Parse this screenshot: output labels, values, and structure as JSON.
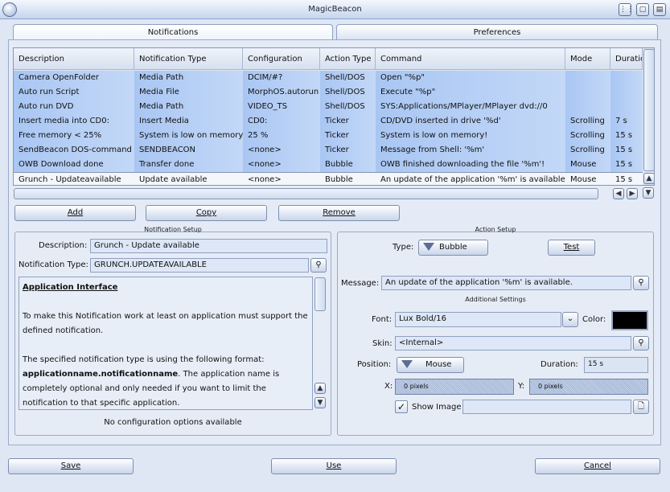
{
  "window": {
    "title": "MagicBeacon",
    "buttons": [
      "⋮⋮",
      "▢",
      "▤"
    ]
  },
  "tabs": [
    {
      "label": "Notifications",
      "active": true
    },
    {
      "label": "Preferences",
      "active": false
    }
  ],
  "list": {
    "columns": [
      "Description",
      "Notification Type",
      "Configuration",
      "Action Type",
      "Command",
      "Mode",
      "Duration"
    ],
    "rows": [
      [
        "Camera OpenFolder",
        "Media Path",
        "DCIM/#?",
        "Shell/DOS",
        "Open \"%p\"",
        "",
        ""
      ],
      [
        "Auto run Script",
        "Media File",
        "MorphOS.autorun",
        "Shell/DOS",
        "Execute \"%p\"",
        "",
        ""
      ],
      [
        "Auto run DVD",
        "Media Path",
        "VIDEO_TS",
        "Shell/DOS",
        "SYS:Applications/MPlayer/MPlayer dvd://0",
        "",
        ""
      ],
      [
        "Insert media into CD0:",
        "Insert Media",
        "CD0:",
        "Ticker",
        "CD/DVD inserted in drive '%d'",
        "Scrolling",
        "7 s"
      ],
      [
        "Free memory < 25%",
        "System is low on memory",
        "25 %",
        "Ticker",
        "System is low on memory!",
        "Scrolling",
        "15 s"
      ],
      [
        "SendBeacon DOS-command",
        "SENDBEACON",
        "<none>",
        "Ticker",
        "Message from Shell: '%m'",
        "Scrolling",
        "15 s"
      ],
      [
        "OWB Download done",
        "Transfer done",
        "<none>",
        "Bubble",
        "OWB finished downloading the file '%m'!",
        "Mouse",
        "15 s"
      ],
      [
        "Grunch - Updateavailable",
        "Update available",
        "<none>",
        "Bubble",
        "An update of the application '%m' is available.",
        "Mouse",
        "15 s"
      ]
    ],
    "selected_index": 7
  },
  "buttons": {
    "add": "Add",
    "copy": "Copy",
    "remove": "Remove",
    "save": "Save",
    "use": "Use",
    "cancel": "Cancel",
    "test": "Test"
  },
  "notification_setup": {
    "title": "Notification Setup",
    "description_label": "Description:",
    "description_value": "Grunch - Update    available",
    "type_label": "Notification Type:",
    "type_value": "GRUNCH.UPDATEAVAILABLE",
    "help_heading": "Application Interface",
    "help_p1": "To make this Notification work at least on application must support the defined notification.",
    "help_p2a": "The specified notification type is using the following format:",
    "help_p2b": "applicationname.notificationname",
    "help_p2c": ". The application name is completely optional and only needed if you want to limit the notification to that specific application.",
    "no_config": "No configuration options available"
  },
  "action_setup": {
    "title": "Action Setup",
    "type_label": "Type:",
    "type_value": "Bubble",
    "message_label": "Message:",
    "message_value": "An update of the application '%m' is available.",
    "additional": "Additional Settings",
    "font_label": "Font:",
    "font_value": "Lux Bold/16",
    "color_label": "Color:",
    "color_value": "#000000",
    "skin_label": "Skin:",
    "skin_value": "<Internal>",
    "position_label": "Position:",
    "position_value": "Mouse",
    "duration_label": "Duration:",
    "duration_value": "15 s",
    "x_label": "X:",
    "x_value": "0 pixels",
    "y_label": "Y:",
    "y_value": "0 pixels",
    "show_image_label": "Show Image",
    "show_image_checked": true
  }
}
